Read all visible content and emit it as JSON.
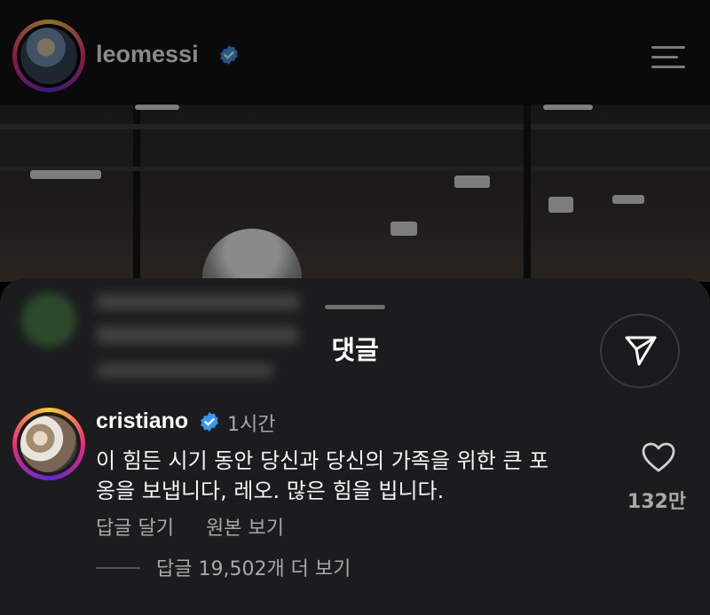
{
  "header": {
    "username": "leomessi",
    "verified_icon": "verified-badge-icon",
    "menu_icon": "hamburger-menu-icon"
  },
  "sheet": {
    "title": "댓글",
    "share_icon": "send-icon"
  },
  "comment": {
    "username": "cristiano",
    "time": "1시간",
    "text_line1": "이 힘든 시기 동안 당신과 당신의 가족을 위한 큰 포",
    "text_line2": "옹을 보냅니다, 레오. 많은 힘을 빕니다.",
    "like_count": "132만",
    "reply_label": "답글 달기",
    "original_label": "원본 보기",
    "more_replies": "답글 19,502개 더 보기"
  },
  "colors": {
    "verified_blue": "#3897f0",
    "sheet_bg": "#1c1c1e",
    "muted_text": "#a8a8a8"
  }
}
